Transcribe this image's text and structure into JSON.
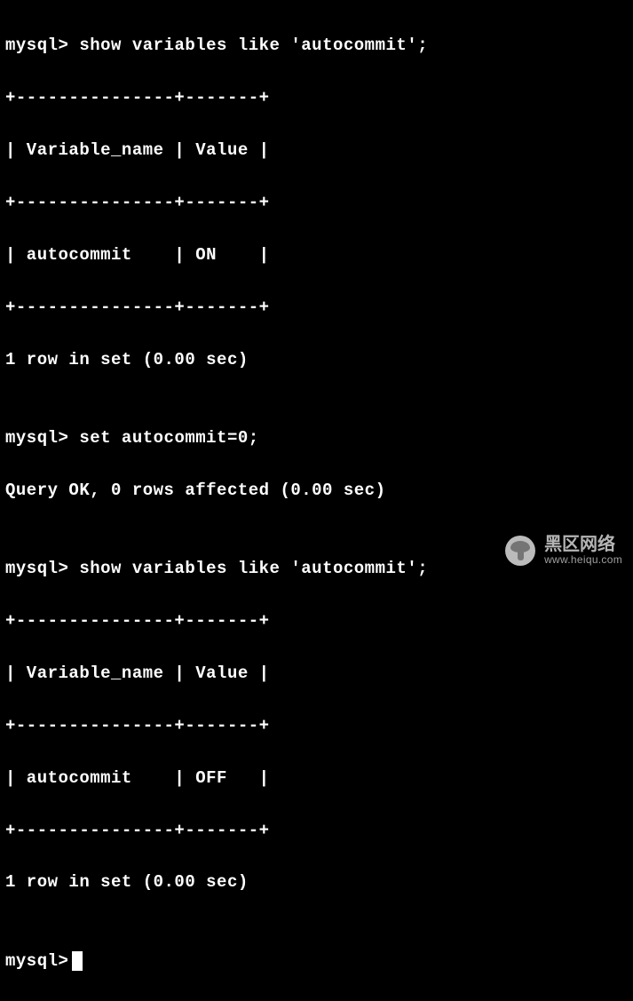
{
  "terminal": {
    "prompt": "mysql>",
    "cmd1": "show variables like 'autocommit';",
    "table1": {
      "border_top": "+---------------+-------+",
      "header_row": "| Variable_name | Value |",
      "border_mid": "+---------------+-------+",
      "data_row": "| autocommit    | ON    |",
      "border_bot": "+---------------+-------+"
    },
    "result1": "1 row in set (0.00 sec)",
    "blank": "",
    "cmd2": "set autocommit=0;",
    "result2": "Query OK, 0 rows affected (0.00 sec)",
    "cmd3": "show variables like 'autocommit';",
    "table2": {
      "border_top": "+---------------+-------+",
      "header_row": "| Variable_name | Value |",
      "border_mid": "+---------------+-------+",
      "data_row": "| autocommit    | OFF   |",
      "border_bot": "+---------------+-------+"
    },
    "result3": "1 row in set (0.00 sec)"
  },
  "watermark": {
    "title": "黑区网络",
    "url": "www.heiqu.com"
  }
}
